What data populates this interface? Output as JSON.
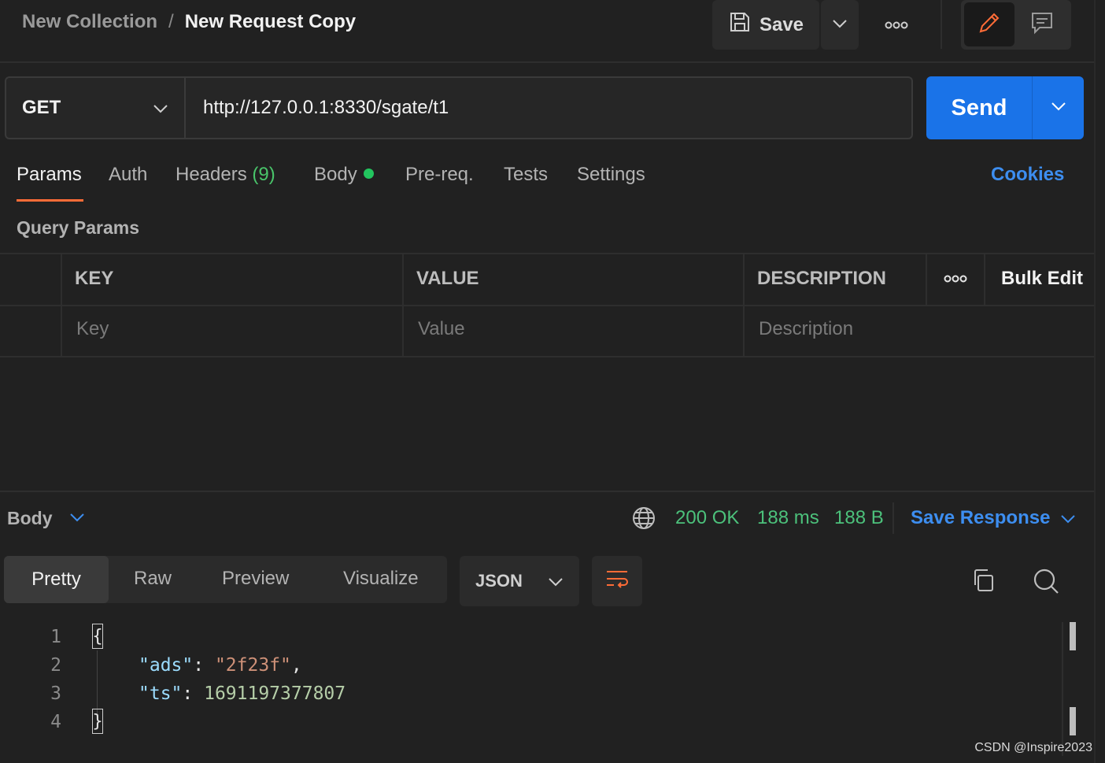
{
  "breadcrumb": {
    "parent": "New Collection",
    "separator": "/",
    "current": "New Request Copy"
  },
  "toolbar": {
    "save_label": "Save"
  },
  "request": {
    "method": "GET",
    "url": "http://127.0.0.1:8330/sgate/t1",
    "send_label": "Send"
  },
  "tabs": {
    "params": "Params",
    "auth": "Auth",
    "headers": "Headers",
    "headers_count": "(9)",
    "body": "Body",
    "prereq": "Pre-req.",
    "tests": "Tests",
    "settings": "Settings",
    "cookies": "Cookies"
  },
  "query_params": {
    "title": "Query Params",
    "columns": {
      "key": "KEY",
      "value": "VALUE",
      "description": "DESCRIPTION"
    },
    "bulk_edit": "Bulk Edit",
    "placeholders": {
      "key": "Key",
      "value": "Value",
      "description": "Description"
    }
  },
  "response": {
    "body_label": "Body",
    "status": "200 OK",
    "time": "188 ms",
    "size": "188 B",
    "save_response": "Save Response",
    "views": {
      "pretty": "Pretty",
      "raw": "Raw",
      "preview": "Preview",
      "visualize": "Visualize"
    },
    "format": "JSON",
    "lines": {
      "n1": "1",
      "n2": "2",
      "n3": "3",
      "n4": "4",
      "open": "{",
      "k1": "\"ads\"",
      "v1": "\"2f23f\"",
      "k2": "\"ts\"",
      "v2": "1691197377807",
      "close": "}"
    }
  },
  "watermark": "CSDN @Inspire2023",
  "colors": {
    "accent": "#ff6c37",
    "send": "#1a73e8",
    "link": "#3d8ef0",
    "status": "#4cc17b"
  }
}
